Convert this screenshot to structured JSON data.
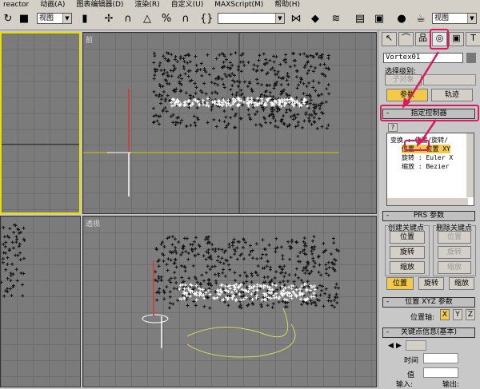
{
  "menu": [
    "reactor",
    "动画(A)",
    "图表编辑器(D)",
    "渲染(R)",
    "自定义(U)",
    "MAXScript(M)",
    "帮助(H)"
  ],
  "toolbar": {
    "view_select_1": "视图",
    "view_select_2": "视图",
    "named_selection": ""
  },
  "viewports": {
    "front_label": "前",
    "perspective_label": "透视"
  },
  "panel": {
    "tabs": [
      "create-icon",
      "modify-icon",
      "hierarchy-icon",
      "motion-icon",
      "display-icon",
      "utilities-icon"
    ],
    "object_name": "Vortex01",
    "selection_level_label": "选择级别:",
    "selection_level_value": "子对象",
    "params_button": "参数",
    "trajectory_button": "轨迹",
    "assign_controller_rollout": "指定控制器",
    "help_button": "?",
    "tree": {
      "root": "变换 : 位置/旋转/",
      "position": "位置 : 位置 XY",
      "rotation": "旋转 : Euler X",
      "scale": "缩放 : Bezier"
    },
    "prs_rollout": "PRS 参数",
    "create_key_label": "创建关键点",
    "delete_key_label": "删除关键点",
    "create_keys": [
      "位置",
      "旋转",
      "缩放"
    ],
    "delete_keys": [
      "位置",
      "旋转",
      "缩放"
    ],
    "mode_buttons": [
      "位置",
      "旋转",
      "缩放"
    ],
    "position_xyz_rollout": "位置 XYZ 参数",
    "position_axis_label": "位置轴:",
    "axes": [
      "X",
      "Y",
      "Z"
    ],
    "key_info_rollout": "关键点信息(基本)",
    "time_label": "时间",
    "value_label": "值",
    "in_label": "输入:",
    "out_label": "输出:"
  },
  "colors": {
    "highlight": "#d81b60",
    "active": "#f2c94c",
    "viewport": "#7b7b7b",
    "active_border": "#e8e000"
  }
}
